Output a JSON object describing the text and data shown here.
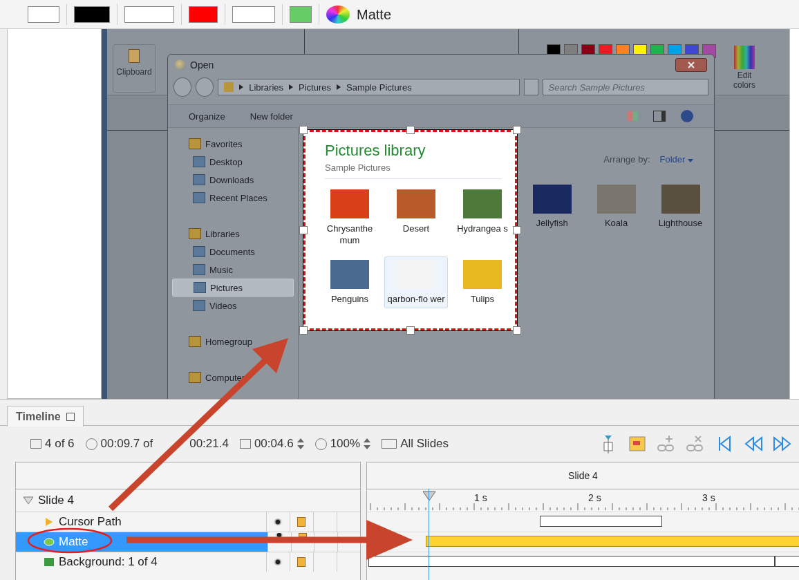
{
  "toolbar": {
    "matte_label": "Matte"
  },
  "paint": {
    "groups": [
      "Clipboard",
      "Edit colors"
    ]
  },
  "open_dialog": {
    "title": "Open",
    "breadcrumb": [
      "Libraries",
      "Pictures",
      "Sample Pictures"
    ],
    "search": {
      "placeholder": "Search Sample Pictures"
    },
    "commands": [
      "Organize",
      "New folder"
    ],
    "nav": [
      {
        "label": "Favorites",
        "kind": "group",
        "selected": false
      },
      {
        "label": "Desktop",
        "kind": "item",
        "selected": false
      },
      {
        "label": "Downloads",
        "kind": "item",
        "selected": false
      },
      {
        "label": "Recent Places",
        "kind": "item",
        "selected": false
      },
      {
        "label": "Libraries",
        "kind": "group",
        "selected": false
      },
      {
        "label": "Documents",
        "kind": "item",
        "selected": false
      },
      {
        "label": "Music",
        "kind": "item",
        "selected": false
      },
      {
        "label": "Pictures",
        "kind": "item",
        "selected": true
      },
      {
        "label": "Videos",
        "kind": "item",
        "selected": false
      },
      {
        "label": "Homegroup",
        "kind": "group",
        "selected": false
      },
      {
        "label": "Computer",
        "kind": "group",
        "selected": false
      }
    ],
    "arrange_label": "Arrange by:",
    "arrange_value": "Folder",
    "files": [
      {
        "name": "Jellyfish"
      },
      {
        "name": "Koala"
      },
      {
        "name": "Lighthouse"
      }
    ]
  },
  "selection": {
    "title": "Pictures library",
    "subtitle": "Sample Pictures",
    "files": [
      {
        "name": "Chrysanthe mum",
        "selected": false
      },
      {
        "name": "Desert",
        "selected": false
      },
      {
        "name": "Hydrangea s",
        "selected": false
      },
      {
        "name": "Penguins",
        "selected": false
      },
      {
        "name": "qarbon-flo wer",
        "selected": true
      },
      {
        "name": "Tulips",
        "selected": false
      }
    ]
  },
  "timeline": {
    "tab": "Timeline",
    "stats": [
      {
        "kind": "slides",
        "text": "4 of 6"
      },
      {
        "kind": "time",
        "text": "00:09.7 of",
        "total": "00:21.4"
      },
      {
        "kind": "duration",
        "text": "00:04.6"
      },
      {
        "kind": "zoom",
        "text": "100%"
      },
      {
        "kind": "all",
        "text": "All Slides"
      }
    ],
    "header": "Slide 4",
    "ruler": [
      "1 s",
      "2 s",
      "3 s"
    ],
    "slide": {
      "name": "Slide 4",
      "expanded": true,
      "children": [
        {
          "name": "Cursor Path",
          "kind": "cursor",
          "selected": false
        },
        {
          "name": "Matte",
          "kind": "matte",
          "selected": true
        },
        {
          "name": "Background: 1 of 4",
          "kind": "background",
          "selected": false
        }
      ]
    }
  }
}
